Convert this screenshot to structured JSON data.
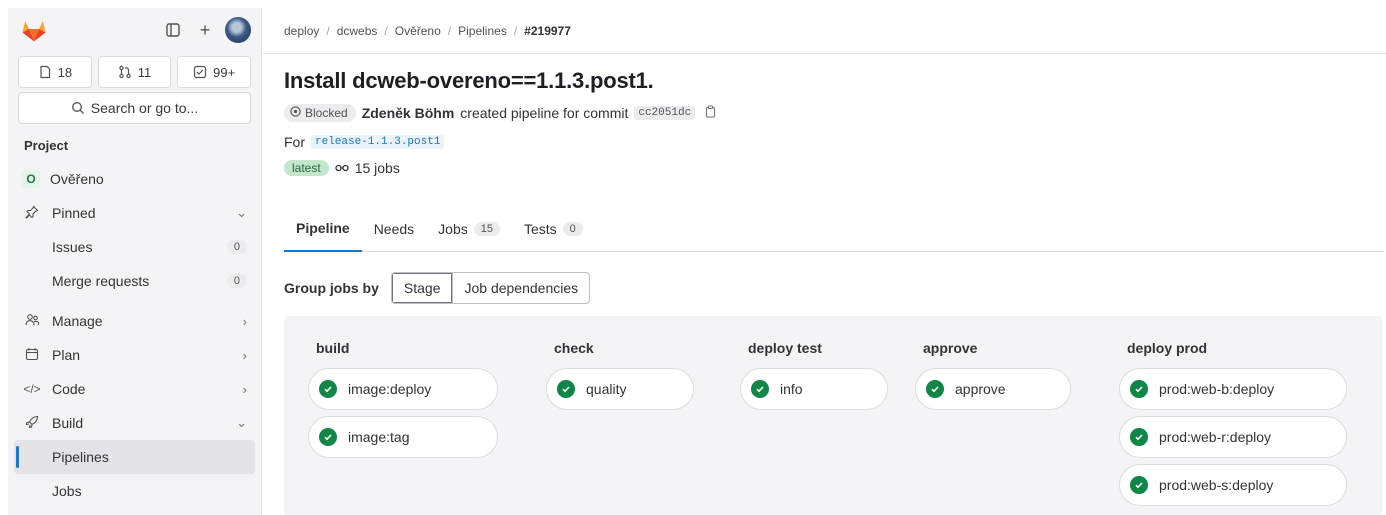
{
  "sidebar": {
    "counts": [
      {
        "icon": "issues-icon",
        "value": "18"
      },
      {
        "icon": "merge-request-icon",
        "value": "11"
      },
      {
        "icon": "todo-icon",
        "value": "99+"
      }
    ],
    "search_label": "Search or go to...",
    "section_title": "Project",
    "project": {
      "letter": "O",
      "name": "Ověřeno"
    },
    "items": [
      {
        "label": "Pinned",
        "icon": "pin-icon",
        "chevron": "down"
      },
      {
        "label": "Issues",
        "count": "0"
      },
      {
        "label": "Merge requests",
        "count": "0"
      },
      {
        "label": "Manage",
        "icon": "people-icon",
        "chevron": "right"
      },
      {
        "label": "Plan",
        "icon": "calendar-icon",
        "chevron": "right"
      },
      {
        "label": "Code",
        "icon": "code-icon",
        "chevron": "right"
      },
      {
        "label": "Build",
        "icon": "rocket-icon",
        "chevron": "down"
      },
      {
        "label": "Pipelines"
      },
      {
        "label": "Jobs"
      }
    ]
  },
  "breadcrumb": [
    "deploy",
    "dcwebs",
    "Ověřeno",
    "Pipelines",
    "#219977"
  ],
  "pipeline": {
    "title": "Install dcweb-overeno==1.1.3.post1.",
    "status": "Blocked",
    "author": "Zdeněk Böhm",
    "action_text": "created pipeline for commit",
    "commit": "cc2051dc",
    "for_label": "For",
    "branch": "release-1.1.3.post1",
    "latest_badge": "latest",
    "jobs_text": "15 jobs"
  },
  "tabs": [
    {
      "label": "Pipeline",
      "active": true
    },
    {
      "label": "Needs"
    },
    {
      "label": "Jobs",
      "count": "15"
    },
    {
      "label": "Tests",
      "count": "0"
    }
  ],
  "group_by": {
    "label": "Group jobs by",
    "options": [
      "Stage",
      "Job dependencies"
    ],
    "selected": "Stage"
  },
  "stages": [
    {
      "name": "build",
      "jobs": [
        "image:deploy",
        "image:tag"
      ]
    },
    {
      "name": "check",
      "jobs": [
        "quality"
      ]
    },
    {
      "name": "deploy test",
      "jobs": [
        "info"
      ]
    },
    {
      "name": "approve",
      "jobs": [
        "approve"
      ]
    },
    {
      "name": "deploy prod",
      "jobs": [
        "prod:web-b:deploy",
        "prod:web-r:deploy",
        "prod:web-s:deploy"
      ]
    }
  ],
  "colors": {
    "success": "#108548",
    "accent": "#1f75cb",
    "brand": "#fc6d26"
  }
}
